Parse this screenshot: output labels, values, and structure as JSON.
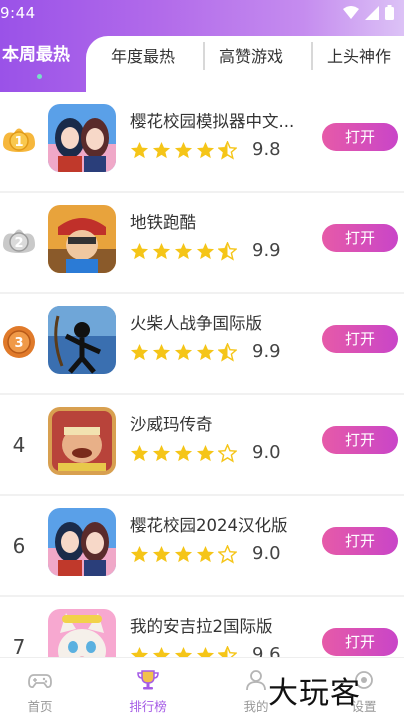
{
  "status_bar": {
    "time": "9:44"
  },
  "tabs": [
    {
      "label": "本周最热",
      "active": true
    },
    {
      "label": "年度最热",
      "active": false
    },
    {
      "label": "高赞游戏",
      "active": false
    },
    {
      "label": "上头神作",
      "active": false
    }
  ],
  "list": [
    {
      "rank": "1",
      "medal": "gold",
      "name": "樱花校园模拟器中文...",
      "rating": 4.5,
      "score": "9.8",
      "button": "打开"
    },
    {
      "rank": "2",
      "medal": "silver",
      "name": "地铁跑酷",
      "rating": 4.5,
      "score": "9.9",
      "button": "打开"
    },
    {
      "rank": "3",
      "medal": "bronze",
      "name": "火柴人战争国际版",
      "rating": 4.5,
      "score": "9.9",
      "button": "打开"
    },
    {
      "rank": "4",
      "medal": "",
      "name": "沙威玛传奇",
      "rating": 4,
      "score": "9.0",
      "button": "打开"
    },
    {
      "rank": "6",
      "medal": "",
      "name": "樱花校园2024汉化版",
      "rating": 4,
      "score": "9.0",
      "button": "打开"
    },
    {
      "rank": "7",
      "medal": "",
      "name": "我的安吉拉2国际版",
      "rating": 4.5,
      "score": "9.6",
      "button": "打开"
    }
  ],
  "bottom_nav": [
    {
      "label": "首页",
      "icon": "gamepad-icon",
      "active": false
    },
    {
      "label": "排行榜",
      "icon": "trophy-icon",
      "active": true
    },
    {
      "label": "我的",
      "icon": "user-icon",
      "active": false
    },
    {
      "label": "设置",
      "icon": "settings-icon",
      "active": false
    }
  ],
  "watermark": "大玩客",
  "colors": {
    "accent": "#a55be6",
    "button_start": "#e65aa8",
    "button_end": "#c945c8",
    "star": "#f5c518"
  }
}
